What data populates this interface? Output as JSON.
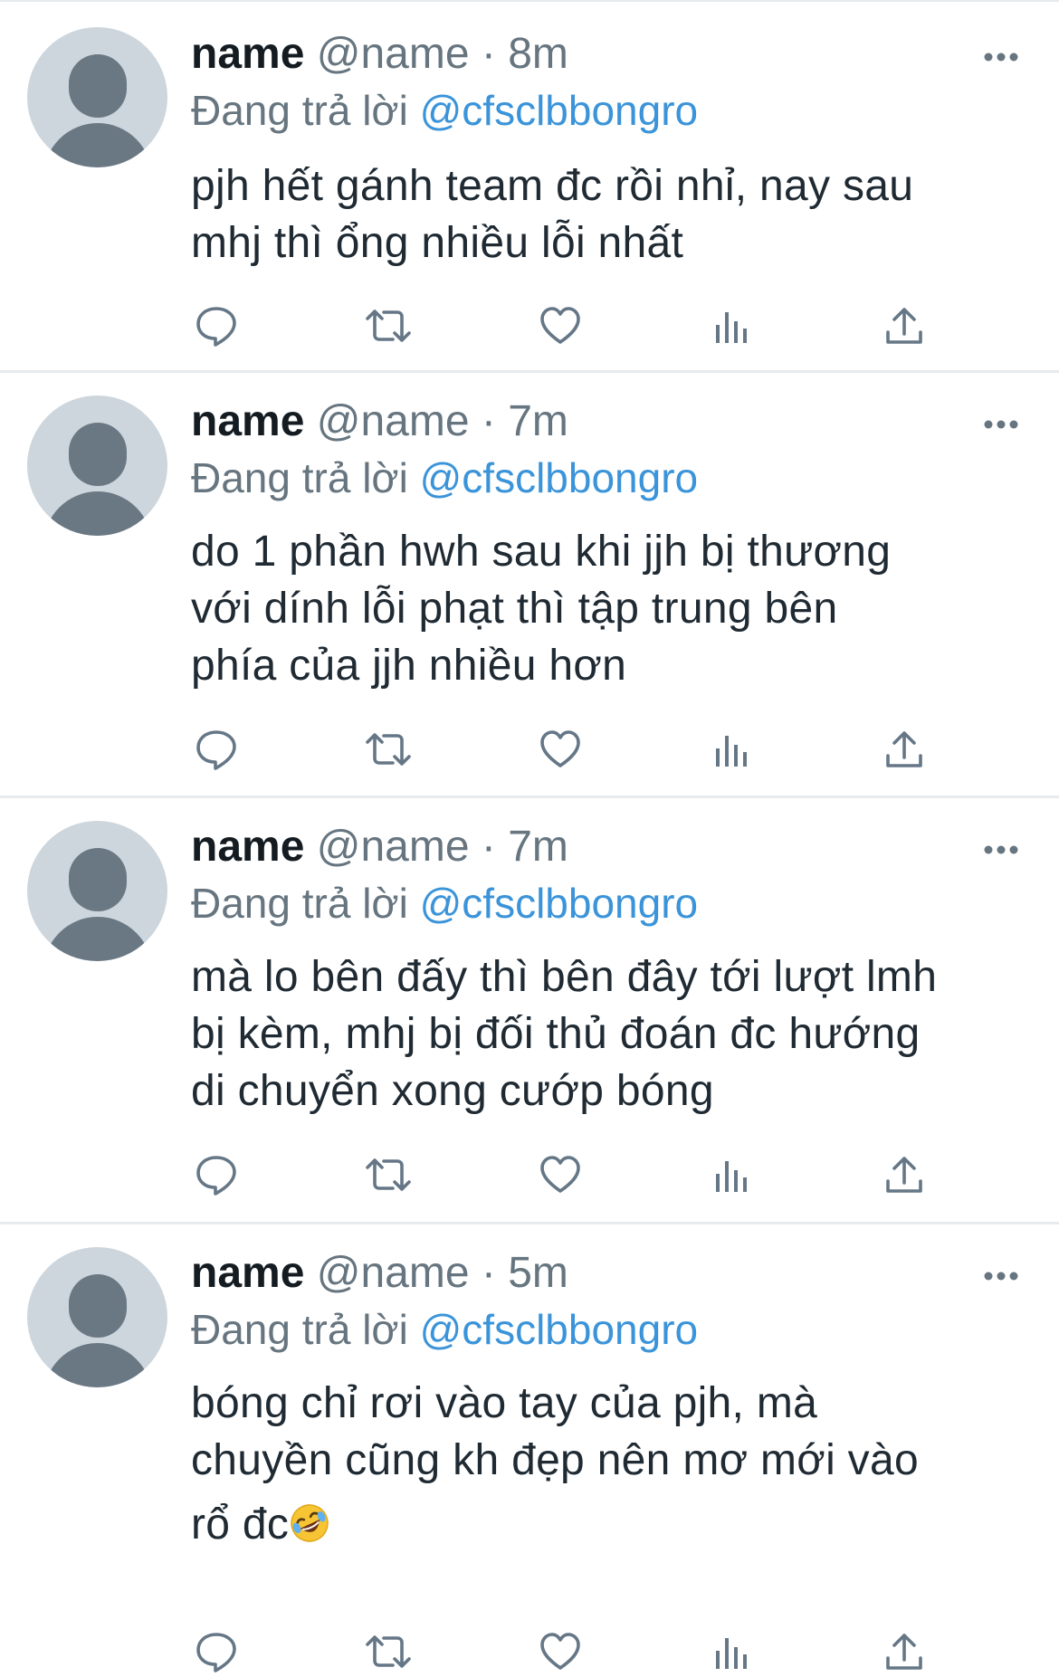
{
  "tweets": [
    {
      "name": "name",
      "handle": "@name",
      "separator": "·",
      "time": "8m",
      "reply_prefix": "Đang trả lời",
      "reply_to": "@cfsclbbongro",
      "text_lines": [
        "pjh hết gánh team đc rồi nhỉ, nay sau",
        "mhj thì ổng nhiều lỗi nhất"
      ]
    },
    {
      "name": "name",
      "handle": "@name",
      "separator": "·",
      "time": "7m",
      "reply_prefix": "Đang trả lời",
      "reply_to": "@cfsclbbongro",
      "text_lines": [
        "do 1 phần hwh sau khi jjh bị thương",
        "với dính lỗi phạt thì tập trung bên",
        "phía của jjh nhiều hơn"
      ]
    },
    {
      "name": "name",
      "handle": "@name",
      "separator": "·",
      "time": "7m",
      "reply_prefix": "Đang trả lời",
      "reply_to": "@cfsclbbongro",
      "text_lines": [
        "mà lo bên đấy thì bên đây tới lượt lmh",
        "bị kèm, mhj bị đối thủ đoán đc hướng",
        "di chuyển xong cướp bóng"
      ]
    },
    {
      "name": "name",
      "handle": "@name",
      "separator": "·",
      "time": "5m",
      "reply_prefix": "Đang trả lời",
      "reply_to": "@cfsclbbongro",
      "text_lines": [
        "bóng chỉ rơi vào tay của pjh, mà",
        "chuyền cũng kh đẹp nên mơ mới vào",
        "rổ đc"
      ]
    }
  ],
  "icons": {
    "more": "more-horizontal-icon",
    "reply": "reply-bubble-icon",
    "retweet": "retweet-icon",
    "like": "heart-icon",
    "analytics": "analytics-bars-icon",
    "share": "share-upload-icon",
    "emoji": "rolling-on-floor-laughing-emoji"
  },
  "colors": {
    "link_blue": "#3b94d9",
    "secondary_gray": "#66757f",
    "icon_gray": "#657786",
    "avatar_bg": "#cdd6dd",
    "avatar_fg": "#6a7884",
    "divider": "#e7ebee"
  }
}
